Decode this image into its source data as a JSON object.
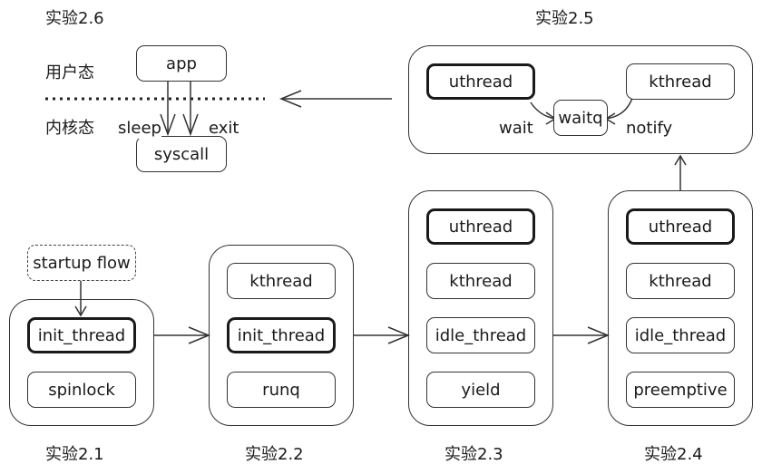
{
  "diagram": {
    "exp_2_1": "实验2.1",
    "exp_2_2": "实验2.2",
    "exp_2_3": "实验2.3",
    "exp_2_4": "实验2.4",
    "exp_2_5": "实验2.5",
    "exp_2_6": "实验2.6",
    "user_mode": "用户态",
    "kernel_mode": "内核态",
    "app": "app",
    "syscall": "syscall",
    "sleep": "sleep",
    "exit": "exit",
    "wait": "wait",
    "waitq": "waitq",
    "notify": "notify",
    "uthread": "uthread",
    "kthread": "kthread",
    "startup_flow": "startup flow",
    "init_thread": "init_thread",
    "spinlock": "spinlock",
    "runq": "runq",
    "idle_thread": "idle_thread",
    "yield": "yield",
    "preemptive": "preemptive"
  }
}
